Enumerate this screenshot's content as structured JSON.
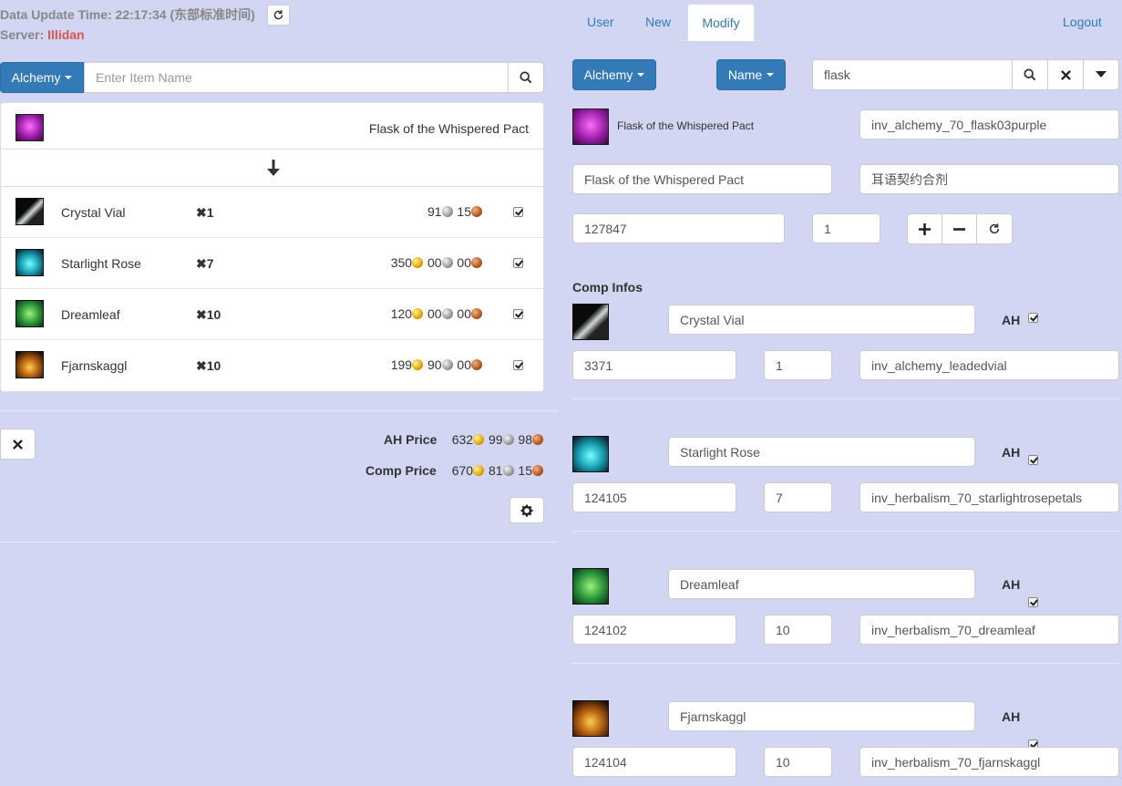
{
  "header": {
    "update_label": "Data Update Time: 22:17:34 (东部标准时间)",
    "server_label": "Server:",
    "server_name": "Illidan",
    "server_color": "#d9534f"
  },
  "left_search": {
    "category": "Alchemy",
    "placeholder": "Enter Item Name"
  },
  "recipe": {
    "product_name": "Flask of the Whispered Pact",
    "components": [
      {
        "name": "Crystal Vial",
        "qty": "✖1",
        "gold": "",
        "silver": "91",
        "copper": "15"
      },
      {
        "name": "Starlight Rose",
        "qty": "✖7",
        "gold": "350",
        "silver": "00",
        "copper": "00"
      },
      {
        "name": "Dreamleaf",
        "qty": "✖10",
        "gold": "120",
        "silver": "00",
        "copper": "00"
      },
      {
        "name": "Fjarnskaggl",
        "qty": "✖10",
        "gold": "199",
        "silver": "90",
        "copper": "00"
      }
    ],
    "ah_price_label": "AH Price",
    "ah_price": {
      "gold": "632",
      "silver": "99",
      "copper": "98"
    },
    "comp_price_label": "Comp Price",
    "comp_price": {
      "gold": "670",
      "silver": "81",
      "copper": "15"
    }
  },
  "tabs": {
    "user": "User",
    "new": "New",
    "modify": "Modify",
    "logout": "Logout"
  },
  "right_search": {
    "category": "Alchemy",
    "field": "Name",
    "query": "flask"
  },
  "item_form": {
    "name_display": "Flask of the Whispered Pact",
    "icon_name": "inv_alchemy_70_flask03purple",
    "name_en": "Flask of the Whispered Pact",
    "name_cn": "耳语契约合剂",
    "item_id": "127847",
    "count": "1"
  },
  "comp_infos": {
    "title": "Comp Infos",
    "ah_label": "AH",
    "items": [
      {
        "name": "Crystal Vial",
        "id": "3371",
        "qty": "1",
        "icon": "inv_alchemy_leadedvial"
      },
      {
        "name": "Starlight Rose",
        "id": "124105",
        "qty": "7",
        "icon": "inv_herbalism_70_starlightrosepetals"
      },
      {
        "name": "Dreamleaf",
        "id": "124102",
        "qty": "10",
        "icon": "inv_herbalism_70_dreamleaf"
      },
      {
        "name": "Fjarnskaggl",
        "id": "124104",
        "qty": "10",
        "icon": "inv_herbalism_70_fjarnskaggl"
      }
    ]
  }
}
